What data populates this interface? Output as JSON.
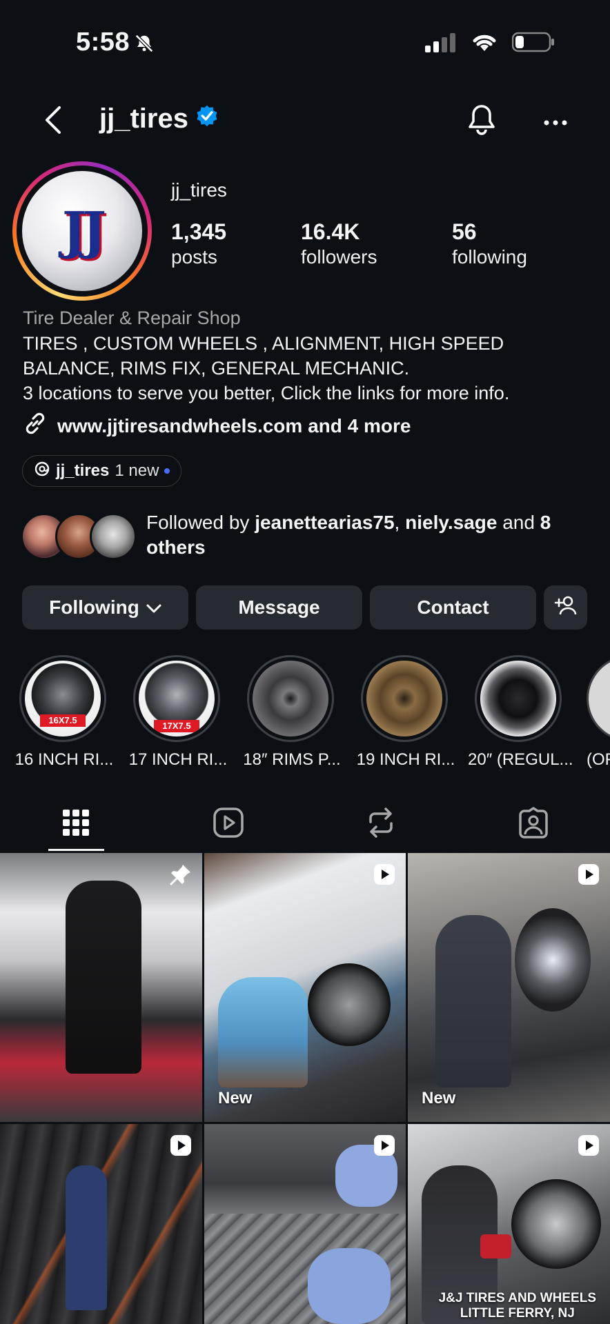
{
  "status_bar": {
    "time": "5:58"
  },
  "header": {
    "username": "jj_tires"
  },
  "profile": {
    "avatar_text": "JJ",
    "name": "jj_tires",
    "stats": [
      {
        "value": "1,345",
        "label": "posts"
      },
      {
        "value": "16.4K",
        "label": "followers"
      },
      {
        "value": "56",
        "label": "following"
      }
    ],
    "category": "Tire Dealer & Repair Shop",
    "bio_lines": [
      "TIRES , CUSTOM WHEELS , ALIGNMENT, HIGH SPEED",
      "BALANCE, RIMS FIX, GENERAL MECHANIC.",
      "3 locations to serve you better, Click the links for more info."
    ],
    "link_text": "www.jjtiresandwheels.com and 4 more",
    "threads": {
      "name": "jj_tires",
      "badge": "1 new"
    },
    "followed_by": {
      "prefix": "Followed by ",
      "user1": "jeanettearias75",
      "sep": ", ",
      "user2": "niely.sage",
      "mid": " and ",
      "others": "8 others"
    }
  },
  "buttons": {
    "following": "Following",
    "message": "Message",
    "contact": "Contact"
  },
  "highlights": [
    {
      "label": "16 INCH RI...",
      "tag": "16X7.5"
    },
    {
      "label": "17 INCH RI...",
      "tag": "17X7.5"
    },
    {
      "label": "18″ RIMS P..."
    },
    {
      "label": "19 INCH RI..."
    },
    {
      "label": "20″ (REGUL..."
    },
    {
      "label": "(OF"
    }
  ],
  "grid": {
    "new_label": "New",
    "caption_line1": "J&J TIRES AND WHEELS",
    "caption_line2": "LITTLE FERRY, NJ"
  },
  "colors": {
    "background": "#0c1014",
    "button": "#262b31",
    "verified": "#0095f6",
    "link": "#e0f1ff"
  }
}
